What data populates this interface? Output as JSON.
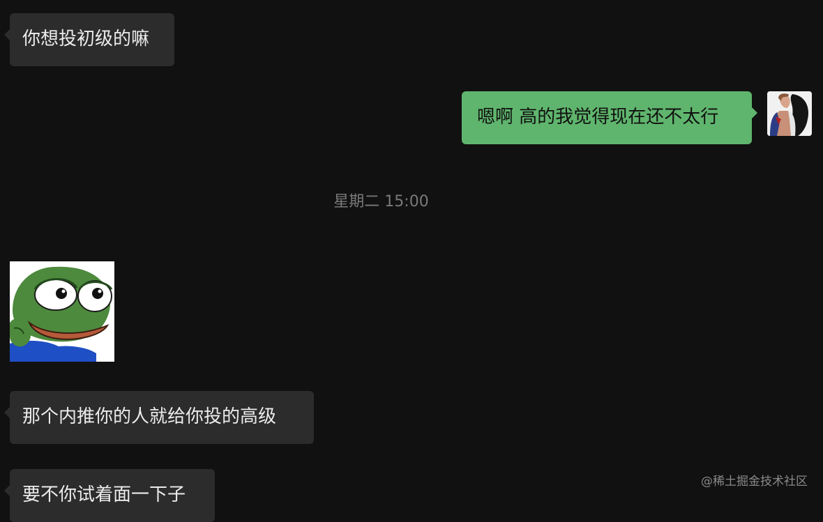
{
  "messages": [
    {
      "direction": "incoming",
      "text": "你想投初级的嘛"
    },
    {
      "direction": "outgoing",
      "text": "嗯啊 高的我觉得现在还不太行"
    },
    {
      "direction": "incoming",
      "text": "那个内推你的人就给你投的高级"
    },
    {
      "direction": "incoming",
      "text": "要不你试着面一下子"
    }
  ],
  "timestamp": "星期二 15:00",
  "sticker": {
    "icon": "pepe-frog-sticker-icon"
  },
  "avatar": {
    "icon": "user-avatar-icon"
  },
  "watermark": "@稀土掘金技术社区",
  "colors": {
    "background": "#111111",
    "incoming_bubble": "#2c2c2c",
    "outgoing_bubble": "#5fb56d",
    "timestamp_text": "#7a7a7a"
  }
}
